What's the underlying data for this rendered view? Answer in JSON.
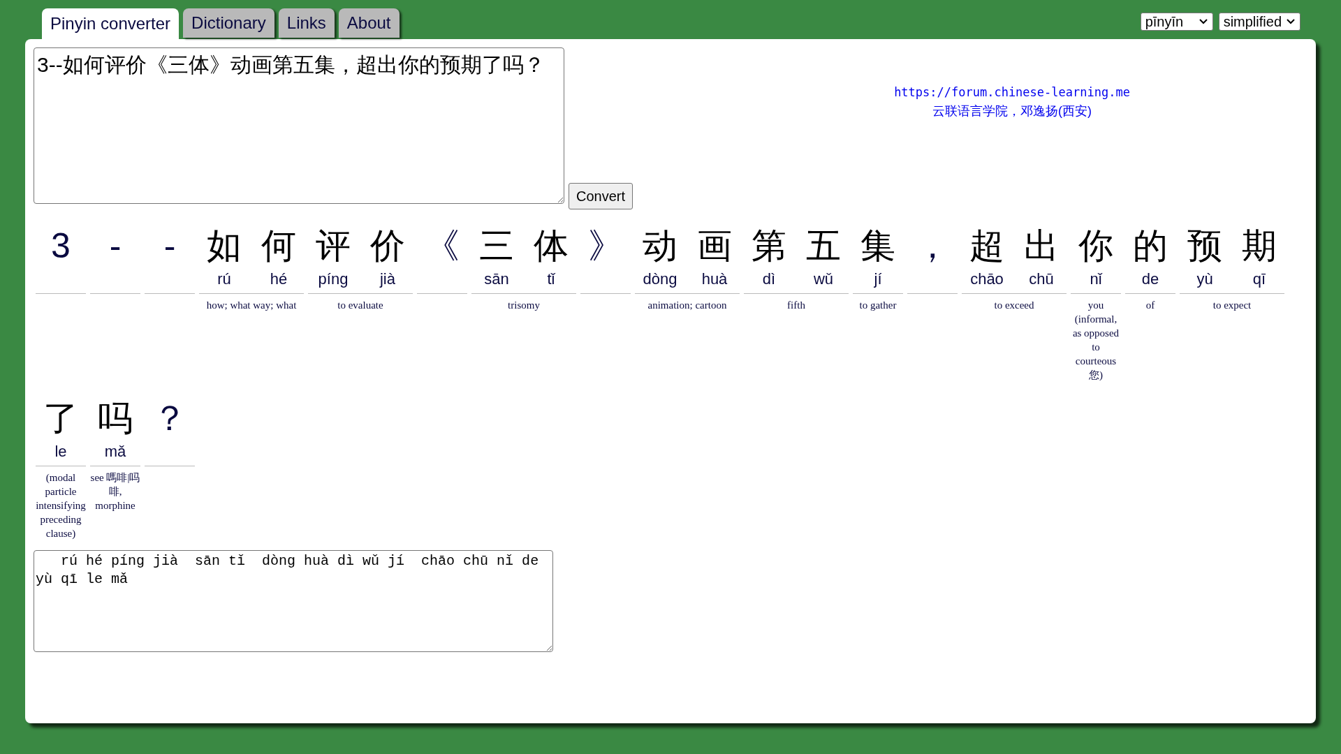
{
  "tabs": [
    {
      "label": "Pinyin converter",
      "selected": true
    },
    {
      "label": "Dictionary",
      "selected": false
    },
    {
      "label": "Links",
      "selected": false
    },
    {
      "label": "About",
      "selected": false
    }
  ],
  "selects": [
    {
      "value": "pīnyīn"
    },
    {
      "value": "simplified"
    }
  ],
  "input": {
    "value": "3--如何评价《三体》动画第五集，超出你的预期了吗？"
  },
  "convert_button": "Convert",
  "credit": {
    "link": "https://forum.chinese-learning.me",
    "author": "云联语言学院，邓逸扬(西安)"
  },
  "words": [
    {
      "kind": "symbol",
      "chars": [
        {
          "hanzi": "3"
        }
      ]
    },
    {
      "kind": "symbol",
      "chars": [
        {
          "hanzi": "-"
        }
      ]
    },
    {
      "kind": "symbol",
      "chars": [
        {
          "hanzi": "-"
        }
      ]
    },
    {
      "kind": "word",
      "chars": [
        {
          "hanzi": "如",
          "pinyin": "rú"
        },
        {
          "hanzi": "何",
          "pinyin": "hé"
        }
      ],
      "definition": "how; what way; what"
    },
    {
      "kind": "word",
      "chars": [
        {
          "hanzi": "评",
          "pinyin": "píng"
        },
        {
          "hanzi": "价",
          "pinyin": "jià"
        }
      ],
      "definition": "to evaluate"
    },
    {
      "kind": "symbol",
      "chars": [
        {
          "hanzi": "《"
        }
      ]
    },
    {
      "kind": "word",
      "chars": [
        {
          "hanzi": "三",
          "pinyin": "sān"
        },
        {
          "hanzi": "体",
          "pinyin": "tǐ"
        }
      ],
      "definition": "trisomy"
    },
    {
      "kind": "symbol",
      "chars": [
        {
          "hanzi": "》"
        }
      ]
    },
    {
      "kind": "word",
      "chars": [
        {
          "hanzi": "动",
          "pinyin": "dòng"
        },
        {
          "hanzi": "画",
          "pinyin": "huà"
        }
      ],
      "definition": "animation; cartoon"
    },
    {
      "kind": "word",
      "chars": [
        {
          "hanzi": "第",
          "pinyin": "dì"
        },
        {
          "hanzi": "五",
          "pinyin": "wǔ"
        }
      ],
      "definition": "fifth"
    },
    {
      "kind": "word",
      "chars": [
        {
          "hanzi": "集",
          "pinyin": "jí"
        }
      ],
      "definition": "to gather"
    },
    {
      "kind": "symbol",
      "chars": [
        {
          "hanzi": "，"
        }
      ]
    },
    {
      "kind": "word",
      "chars": [
        {
          "hanzi": "超",
          "pinyin": "chāo"
        },
        {
          "hanzi": "出",
          "pinyin": "chū"
        }
      ],
      "definition": "to exceed"
    },
    {
      "kind": "word",
      "chars": [
        {
          "hanzi": "你",
          "pinyin": "nǐ"
        }
      ],
      "definition": "you (informal, as opposed to courteous 您)"
    },
    {
      "kind": "word",
      "chars": [
        {
          "hanzi": "的",
          "pinyin": "de"
        }
      ],
      "definition": "of"
    },
    {
      "kind": "word",
      "chars": [
        {
          "hanzi": "预",
          "pinyin": "yù"
        },
        {
          "hanzi": "期",
          "pinyin": "qī"
        }
      ],
      "definition": "to expect"
    },
    {
      "kind": "word",
      "chars": [
        {
          "hanzi": "了",
          "pinyin": "le"
        }
      ],
      "definition": "(modal particle intensifying preceding clause)"
    },
    {
      "kind": "word",
      "chars": [
        {
          "hanzi": "吗",
          "pinyin": "mǎ"
        }
      ],
      "definition": "see 嗎啡|吗啡, morphine"
    },
    {
      "kind": "symbol",
      "chars": [
        {
          "hanzi": "？"
        }
      ]
    }
  ],
  "output": {
    "value": "   rú hé píng jià  sān tǐ  dòng huà dì wǔ jí  chāo chū nǐ de yù qī le mǎ"
  }
}
